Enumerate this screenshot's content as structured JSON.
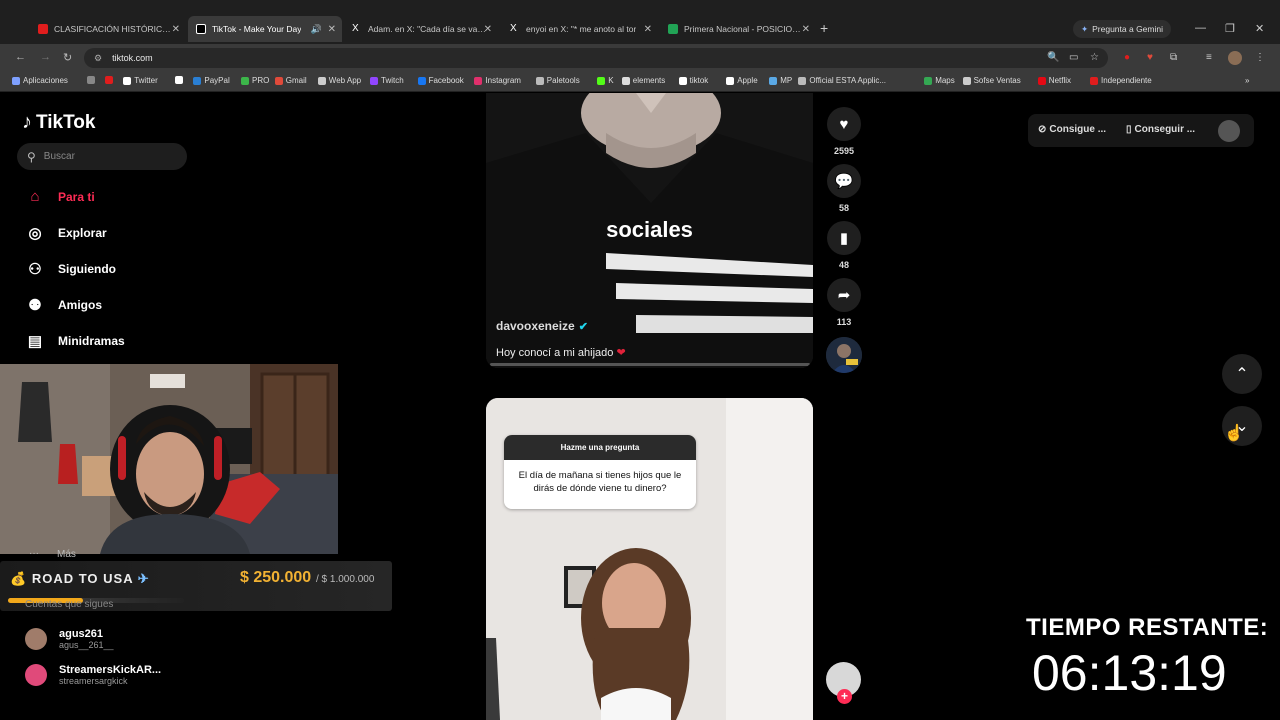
{
  "browser": {
    "tabs": [
      {
        "label": "CLASIFICACIÓN HISTÓRICA A C",
        "favicon_color": "#e01d1d",
        "active": false
      },
      {
        "label": "TikTok - Make Your Day",
        "favicon_color": "#ffffff",
        "active": true
      },
      {
        "label": "Adam. en X: \"Cada día se va nc",
        "favicon_color": "#ffffff",
        "active": false
      },
      {
        "label": "enyoi en X: \"* me anoto al tor",
        "favicon_color": "#ffffff",
        "active": false
      },
      {
        "label": "Primera Nacional - POSICIONES",
        "favicon_color": "#21a355",
        "active": false
      }
    ],
    "new_tab": "+",
    "gemini_label": "Pregunta a Gemini",
    "url": "tiktok.com",
    "bookmarks": [
      {
        "label": "Aplicaciones",
        "color": "#7ea0ff"
      },
      {
        "label": "",
        "color": "#888888"
      },
      {
        "label": "",
        "color": "#e01d1d"
      },
      {
        "label": "Twitter",
        "color": "#ffffff"
      },
      {
        "label": "",
        "color": "#ffffff"
      },
      {
        "label": "PayPal",
        "color": "#2a7fd4"
      },
      {
        "label": "PRO",
        "color": "#3cb64a"
      },
      {
        "label": "Gmail",
        "color": "#e04a3a"
      },
      {
        "label": "Web App",
        "color": "#cccccc"
      },
      {
        "label": "Twitch",
        "color": "#9146ff"
      },
      {
        "label": "Facebook",
        "color": "#1877f2"
      },
      {
        "label": "Instagram",
        "color": "#e1306c"
      },
      {
        "label": "Paletools",
        "color": "#bbbbbb"
      },
      {
        "label": "K",
        "color": "#53fc18"
      },
      {
        "label": "elements",
        "color": "#dddddd"
      },
      {
        "label": "tiktok",
        "color": "#ffffff"
      },
      {
        "label": "Apple",
        "color": "#ffffff"
      },
      {
        "label": "MP",
        "color": "#5aa9e6"
      },
      {
        "label": "Official ESTA Applic...",
        "color": "#bbbbbb"
      },
      {
        "label": "Maps",
        "color": "#34a853"
      },
      {
        "label": "Sofse Ventas",
        "color": "#cccccc"
      },
      {
        "label": "Netflix",
        "color": "#e50914"
      },
      {
        "label": "Independiente",
        "color": "#e01d1d"
      }
    ]
  },
  "tiktok": {
    "logo": "TikTok",
    "search_placeholder": "Buscar",
    "nav": [
      {
        "label": "Para ti",
        "icon": "home-icon"
      },
      {
        "label": "Explorar",
        "icon": "compass-icon"
      },
      {
        "label": "Siguiendo",
        "icon": "user-follow-icon"
      },
      {
        "label": "Amigos",
        "icon": "friends-icon"
      },
      {
        "label": "Minidramas",
        "icon": "film-icon"
      }
    ],
    "more_label": "Más",
    "following_title": "Cuentas que sigues",
    "accounts": [
      {
        "name": "agus261",
        "handle": "agus__261__"
      },
      {
        "name": "StreamersKickAR...",
        "handle": "streamersargkick"
      }
    ],
    "top_right": {
      "coins_label": "Consigue ...",
      "app_label": "Conseguir ..."
    }
  },
  "video1": {
    "overlay_text": "sociales",
    "username": "davooxeneize",
    "description": "Hoy conocí a mi ahijado",
    "likes": "2595",
    "comments": "58",
    "saves": "48",
    "shares": "113"
  },
  "video2": {
    "question_title": "Hazme una pregunta",
    "question_text": "El día de mañana si tienes hijos que le dirás de dónde viene tu dinero?"
  },
  "overlay": {
    "road_title": "ROAD TO USA",
    "road_amount": "$ 250.000",
    "road_goal": "/ $ 1.000.000",
    "road_progress": 0.25,
    "timer_label": "TIEMPO RESTANTE:",
    "timer_value": "06:13:19"
  },
  "colors": {
    "accent": "#fe2c55",
    "gold": "#f2b233"
  }
}
